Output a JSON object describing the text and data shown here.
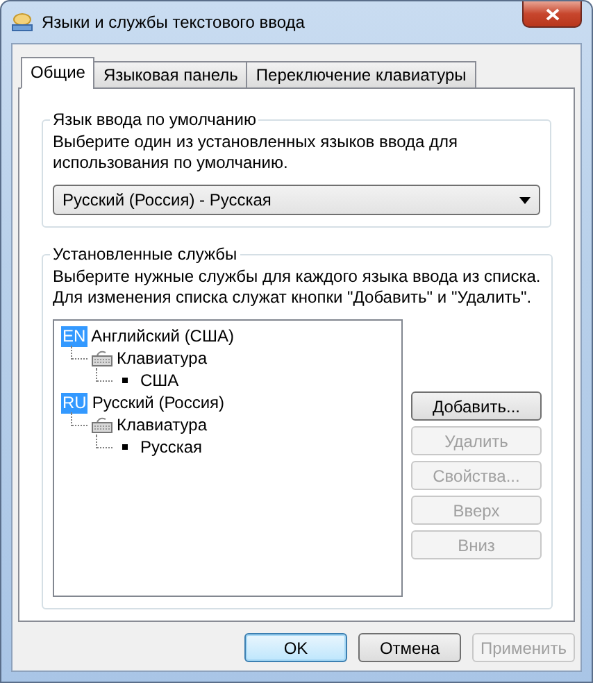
{
  "window": {
    "title": "Языки и службы текстового ввода"
  },
  "tabs": [
    {
      "label": "Общие",
      "selected": true
    },
    {
      "label": "Языковая панель",
      "selected": false
    },
    {
      "label": "Переключение клавиатуры",
      "selected": false
    }
  ],
  "default_language": {
    "legend": "Язык ввода по умолчанию",
    "description": "Выберите один из установленных языков ввода для использования по умолчанию.",
    "dropdown": {
      "value": "Русский (Россия) - Русская"
    }
  },
  "installed_services": {
    "legend": "Установленные службы",
    "description": "Выберите нужные службы для каждого языка ввода из списка. Для изменения списка служат кнопки \"Добавить\" и \"Удалить\".",
    "tree": [
      {
        "kind": "language",
        "badge": "EN",
        "label": "Английский (США)",
        "children": [
          {
            "kind": "keyboard",
            "label": "Клавиатура",
            "children": [
              {
                "kind": "layout",
                "label": "США"
              }
            ]
          }
        ]
      },
      {
        "kind": "language",
        "badge": "RU",
        "label": "Русский (Россия)",
        "children": [
          {
            "kind": "keyboard",
            "label": "Клавиатура",
            "children": [
              {
                "kind": "layout",
                "label": "Русская"
              }
            ]
          }
        ]
      }
    ],
    "buttons": [
      {
        "label": "Добавить...",
        "disabled": false
      },
      {
        "label": "Удалить",
        "disabled": true
      },
      {
        "label": "Свойства...",
        "disabled": true
      },
      {
        "label": "Вверх",
        "disabled": true
      },
      {
        "label": "Вниз",
        "disabled": true
      }
    ]
  },
  "footer_buttons": [
    {
      "label": "OK",
      "disabled": false,
      "default": true
    },
    {
      "label": "Отмена",
      "disabled": false,
      "default": false
    },
    {
      "label": "Применить",
      "disabled": true,
      "default": false
    }
  ]
}
